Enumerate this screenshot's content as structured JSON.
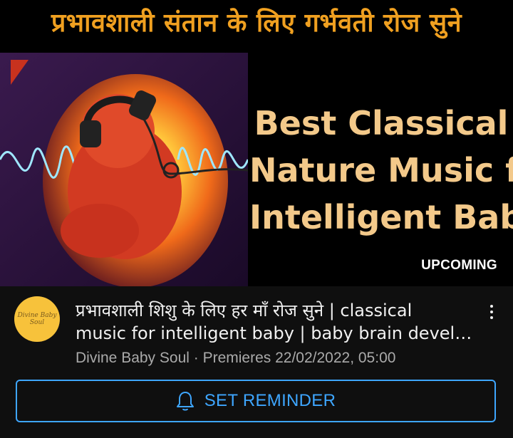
{
  "thumbnail": {
    "hindi_title": "प्रभावशाली संतान के लिए गर्भवती रोज सुने",
    "english_lines": [
      "Best Classical",
      "Nature Music for",
      "Intelligent Baby"
    ],
    "badge": "UPCOMING"
  },
  "video": {
    "channel_avatar_text": "Divine Baby Soul",
    "title_line1": "प्रभावशाली शिशु के लिए हर माँ रोज सुने  | classical",
    "title_line2": "music for intelligent baby | baby brain devel…",
    "meta": "Divine Baby Soul · Premieres 22/02/2022, 05:00",
    "more_icon": "vertical-ellipsis-icon"
  },
  "reminder": {
    "label": "SET REMINDER",
    "icon": "bell-icon"
  },
  "colors": {
    "accent": "#3ea6ff",
    "thumb_title": "#f0a020",
    "thumb_english": "#f3c98a",
    "background": "#0f0f0f"
  }
}
